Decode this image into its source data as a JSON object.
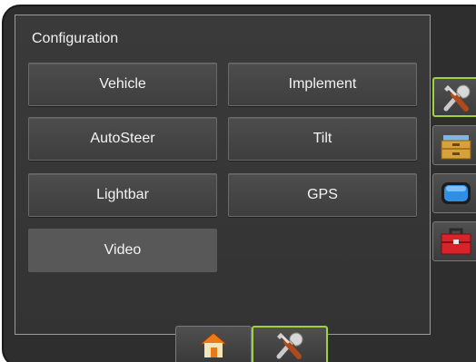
{
  "panel": {
    "title": "Configuration"
  },
  "buttons": {
    "vehicle": "Vehicle",
    "implement": "Implement",
    "autosteer": "AutoSteer",
    "tilt": "Tilt",
    "lightbar": "Lightbar",
    "gps": "GPS",
    "video": "Video"
  },
  "side_tabs": [
    {
      "icon": "tools-icon",
      "active": true
    },
    {
      "icon": "file-drawer-icon",
      "active": false
    },
    {
      "icon": "screen-icon",
      "active": false
    },
    {
      "icon": "toolbox-icon",
      "active": false
    }
  ],
  "bottom_tabs": [
    {
      "icon": "home-icon",
      "active": false
    },
    {
      "icon": "tools-icon",
      "active": true
    }
  ],
  "colors": {
    "accent": "#9fd13a",
    "panel_bg": "#363636",
    "button_bg": "#474747",
    "selected_button_bg": "#585858"
  }
}
